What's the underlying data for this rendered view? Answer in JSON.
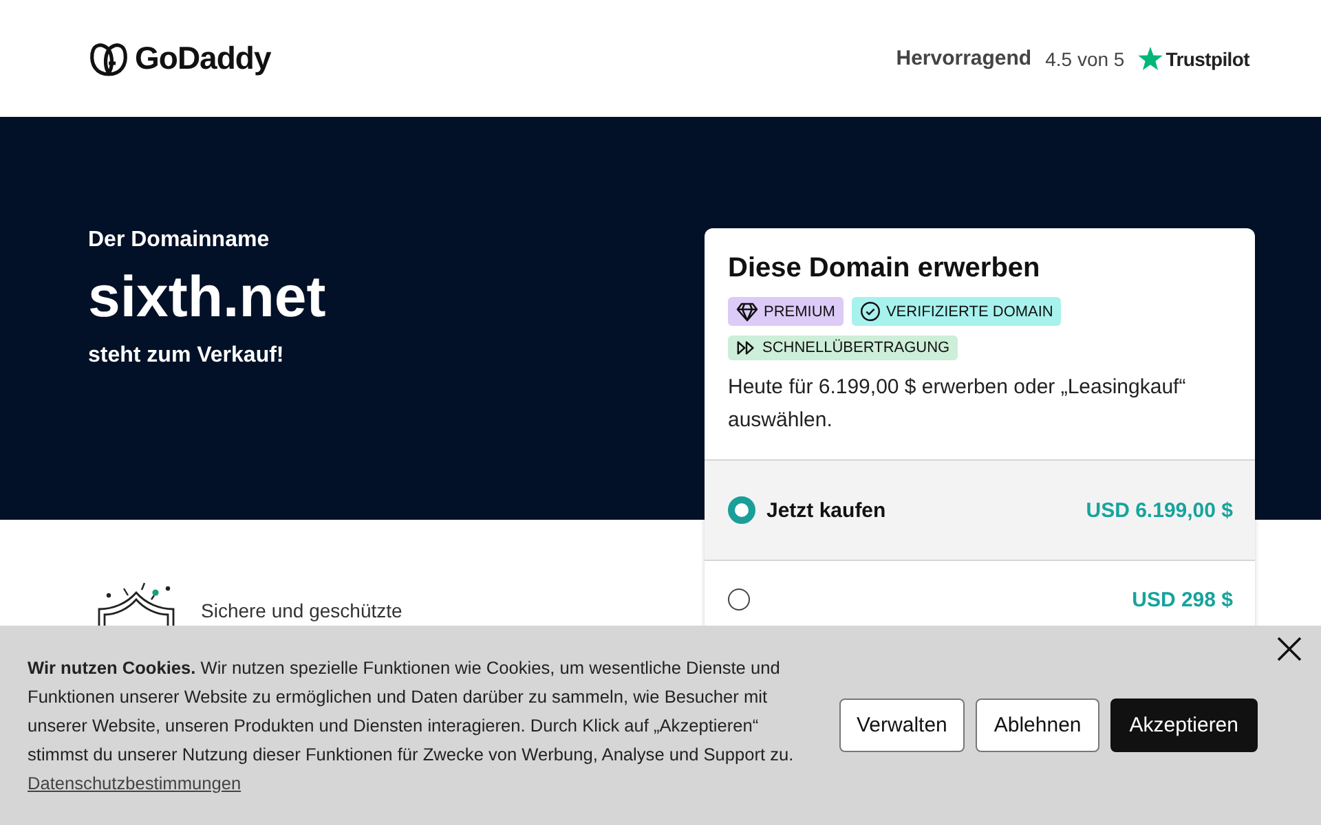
{
  "header": {
    "logo": "GoDaddy",
    "rating": {
      "label": "Hervorragend",
      "score": "4.5 von 5",
      "brand": "Trustpilot"
    }
  },
  "hero": {
    "eyebrow": "Der Domainname",
    "domain": "sixth.net",
    "subtitle": "steht zum Verkauf!"
  },
  "card": {
    "title": "Diese Domain erwerben",
    "badges": [
      {
        "kind": "diamond",
        "label": "PREMIUM",
        "color": "#dccbf7"
      },
      {
        "kind": "check",
        "label": "VERIFIZIERTE DOMAIN",
        "color": "#a8f2ee"
      },
      {
        "kind": "fast",
        "label": "SCHNELLÜBERTRAGUNG",
        "color": "#cdeed8"
      }
    ],
    "description": "Heute für 6.199,00 $ erwerben oder „Leasingkauf“ auswählen.",
    "options": [
      {
        "label": "Jetzt kaufen",
        "price": "USD 6.199,00 $",
        "selected": true
      },
      {
        "price": "USD 298 $",
        "selected": false
      }
    ]
  },
  "features": [
    {
      "label": "Sichere und geschützte"
    }
  ],
  "cookie_banner": {
    "heading": "Wir nutzen Cookies.",
    "text": "Wir nutzen spezielle Funktionen wie Cookies, um wesentliche Dienste und Funktionen unserer Website zu ermöglichen und Daten darüber zu sammeln, wie Besucher mit unserer Website, unseren Produkten und Diensten interagieren. Durch Klick auf „Akzeptieren“ stimmst du unserer Nutzung dieser Funktionen für Zwecke von Werbung, Analyse und Support zu.",
    "link": "Datenschutzbestimmungen",
    "buttons": [
      {
        "label": "Verwalten",
        "kind": "outline"
      },
      {
        "label": "Ablehnen",
        "kind": "outline"
      },
      {
        "label": "Akzeptieren",
        "kind": "primary"
      }
    ]
  }
}
